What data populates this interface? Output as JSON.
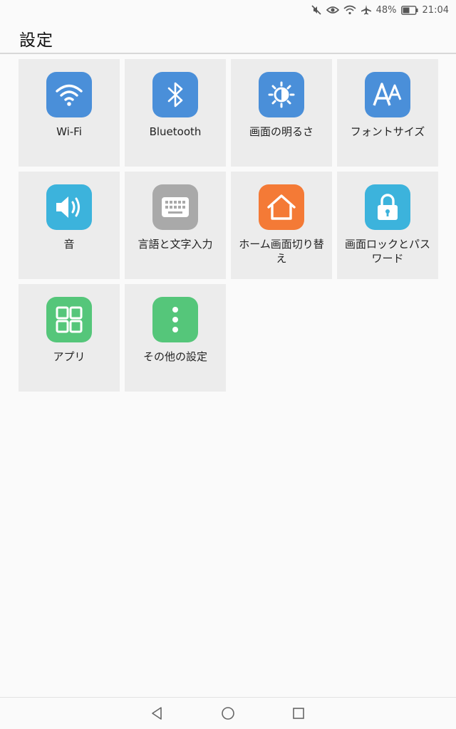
{
  "status_bar": {
    "battery_percent": "48%",
    "time": "21:04",
    "icons": [
      "mute-icon",
      "eye-comfort-icon",
      "wifi-icon",
      "airplane-icon",
      "battery-icon"
    ]
  },
  "header": {
    "title": "設定"
  },
  "tiles": [
    {
      "label": "Wi-Fi",
      "icon": "wifi-icon",
      "color": "#4a8fd9"
    },
    {
      "label": "Bluetooth",
      "icon": "bluetooth-icon",
      "color": "#4a8fd9"
    },
    {
      "label": "画面の明るさ",
      "icon": "brightness-icon",
      "color": "#4a8fd9"
    },
    {
      "label": "フォントサイズ",
      "icon": "font-size-icon",
      "color": "#4a8fd9"
    },
    {
      "label": "音",
      "icon": "speaker-icon",
      "color": "#3cb3dc"
    },
    {
      "label": "言語と文字入力",
      "icon": "keyboard-icon",
      "color": "#a9a9a9"
    },
    {
      "label": "ホーム画面切り替え",
      "icon": "home-icon",
      "color": "#f47a36"
    },
    {
      "label": "画面ロックとパスワード",
      "icon": "lock-icon",
      "color": "#3cb3dc"
    },
    {
      "label": "アプリ",
      "icon": "apps-grid-icon",
      "color": "#55c67a"
    },
    {
      "label": "その他の設定",
      "icon": "more-vertical-icon",
      "color": "#55c67a"
    }
  ],
  "nav_bar": {
    "icons": [
      "back-icon",
      "home-circle-icon",
      "recents-icon"
    ]
  }
}
